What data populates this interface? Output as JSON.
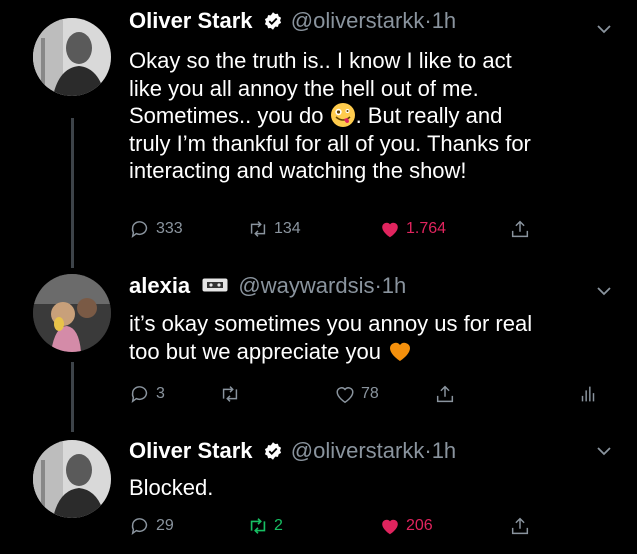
{
  "tweets": [
    {
      "name": "Oliver Stark",
      "handle": "@oliverstarkk",
      "dot": "·",
      "time": "1h",
      "text_lines": [
        "Okay so the truth is.. I know I like to act",
        "like you all annoy the hell out of me.",
        "Sometimes.. you do",
        ". But really and",
        "truly I’m thankful for all of you. Thanks for",
        "interacting and watching the show!"
      ],
      "emoji": "zany-face",
      "replies": "333",
      "retweets": "134",
      "likes": "1.764"
    },
    {
      "name": "alexia",
      "handle": "@waywardsis",
      "dot": "·",
      "time": "1h",
      "text_lines": [
        "it’s okay sometimes you annoy us for real",
        "too but we appreciate you"
      ],
      "emoji": "orange-heart",
      "replies": "3",
      "retweets": "",
      "likes": "78"
    },
    {
      "name": "Oliver Stark",
      "handle": "@oliverstarkk",
      "dot": "·",
      "time": "1h",
      "text_lines": [
        "Blocked."
      ],
      "replies": "29",
      "retweets": "2",
      "likes": "206"
    }
  ],
  "colors": {
    "background": "#000000",
    "muted": "#8a949e",
    "like": "#e0245e",
    "retweet": "#17bf63",
    "verified": "#ffffff"
  }
}
